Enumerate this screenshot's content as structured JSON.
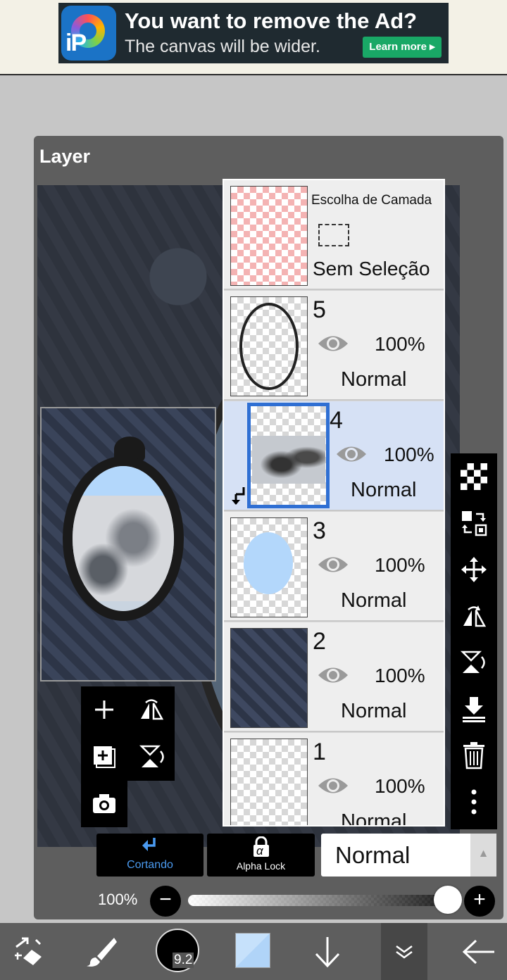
{
  "ad": {
    "title": "You want to remove the Ad?",
    "subtitle": "The canvas will be wider.",
    "button_label": "Learn more ▸",
    "logo_text": "iP"
  },
  "panel": {
    "title": "Layer"
  },
  "selection_layer": {
    "title": "Escolha de Camada",
    "status": "Sem Seleção"
  },
  "layers": [
    {
      "number": "5",
      "opacity": "100%",
      "blend": "Normal",
      "visible": true,
      "thumbnail": "ornate-frame",
      "active": false
    },
    {
      "number": "4",
      "opacity": "100%",
      "blend": "Normal",
      "visible": true,
      "thumbnail": "hands-photo",
      "active": true,
      "clipped": true
    },
    {
      "number": "3",
      "opacity": "100%",
      "blend": "Normal",
      "visible": true,
      "thumbnail": "blue-oval",
      "active": false
    },
    {
      "number": "2",
      "opacity": "100%",
      "blend": "Normal",
      "visible": true,
      "thumbnail": "damask-wallpaper",
      "active": false
    },
    {
      "number": "1",
      "opacity": "100%",
      "blend": "Normal",
      "visible": true,
      "thumbnail": "empty",
      "active": false
    }
  ],
  "mini_tools": [
    "add-layer-icon",
    "flip-horizontal-icon",
    "add-layer-copy-icon",
    "flip-vertical-icon",
    "camera-icon"
  ],
  "right_tools": [
    "checker-icon",
    "transfer-icon",
    "move-icon",
    "flip-horizontal-icon",
    "flip-vertical-icon",
    "merge-down-icon",
    "trash-icon",
    "more-icon"
  ],
  "controls": {
    "clipping_label": "Cortando",
    "alpha_lock_label": "Alpha Lock",
    "alpha_symbol": "α",
    "blend_mode": "Normal",
    "opacity_label": "100%",
    "opacity_value": 1.0,
    "minus": "−",
    "plus": "+"
  },
  "bottom_nav": {
    "brush_size": "9.2",
    "items": [
      "transform-icon",
      "brush-icon",
      "brush-size",
      "color-swatch",
      "arrow-down-icon",
      "layers-toggle-icon",
      "back-icon"
    ]
  },
  "colors": {
    "accent_blue": "#2f6fd3",
    "clip_blue": "#4b9bf1",
    "active_row": "#d6e1f5",
    "panel_bg": "#5e5e5e",
    "current_color": "#b3d7fb"
  }
}
